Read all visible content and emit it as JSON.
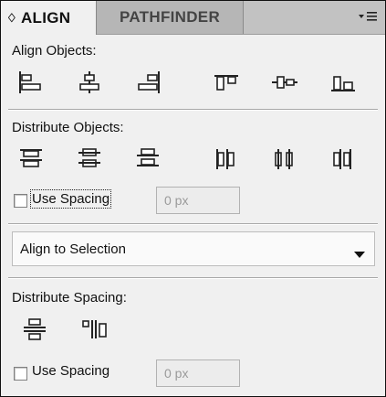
{
  "tabs": [
    {
      "label": "ALIGN",
      "caret": "♢",
      "active": true
    },
    {
      "label": "PATHFINDER",
      "active": false
    }
  ],
  "panel_menu_icon": "panel-menu-icon",
  "align_objects": {
    "label": "Align Objects:",
    "buttons": [
      {
        "icon": "horizontal-align-left-icon"
      },
      {
        "icon": "horizontal-align-center-icon"
      },
      {
        "icon": "horizontal-align-right-icon"
      },
      {
        "icon": "vertical-align-top-icon"
      },
      {
        "icon": "vertical-align-center-icon"
      },
      {
        "icon": "vertical-align-bottom-icon"
      }
    ]
  },
  "distribute_objects": {
    "label": "Distribute Objects:",
    "buttons": [
      {
        "icon": "vertical-distribute-top-icon"
      },
      {
        "icon": "vertical-distribute-center-icon"
      },
      {
        "icon": "vertical-distribute-bottom-icon"
      },
      {
        "icon": "horizontal-distribute-left-icon"
      },
      {
        "icon": "horizontal-distribute-center-icon"
      },
      {
        "icon": "horizontal-distribute-right-icon"
      }
    ],
    "use_spacing_label": "Use Spacing",
    "use_spacing_checked": false,
    "spacing_value": "0 px"
  },
  "align_to": {
    "selected": "Align to Selection"
  },
  "distribute_spacing": {
    "label": "Distribute Spacing:",
    "buttons": [
      {
        "icon": "vertical-distribute-space-icon"
      },
      {
        "icon": "horizontal-distribute-space-icon"
      }
    ],
    "use_spacing_label": "Use Spacing",
    "use_spacing_checked": false,
    "spacing_value": "0 px"
  }
}
